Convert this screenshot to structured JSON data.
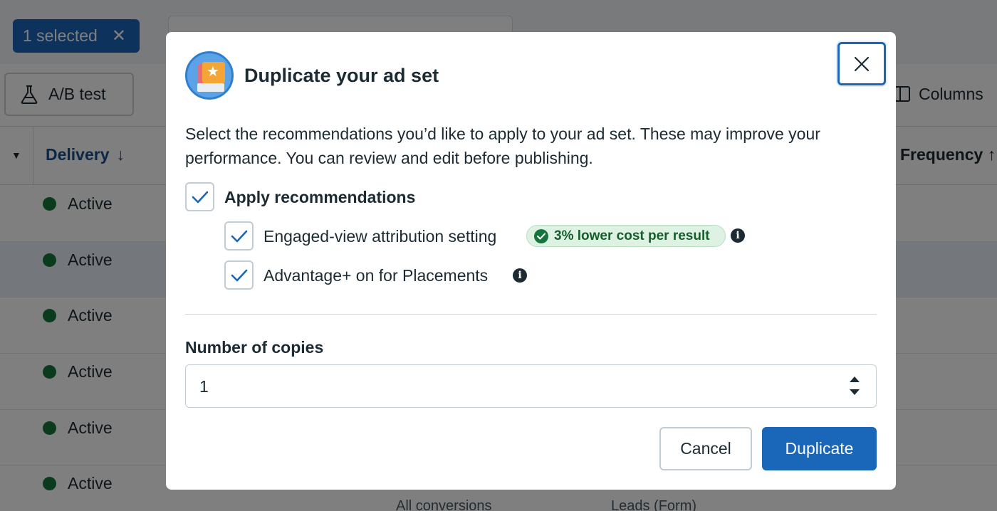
{
  "background": {
    "selection": {
      "label": "1 selected",
      "clear_glyph": "✕"
    },
    "toolbar": {
      "ab_test_label": "A/B test",
      "columns_label": "Columns"
    },
    "table": {
      "header_delivery": "Delivery",
      "header_delivery_sort": "↓",
      "header_frequency": "Frequency ↑",
      "rows": [
        {
          "status": "Active"
        },
        {
          "status": "Active"
        },
        {
          "status": "Active"
        },
        {
          "status": "Active"
        },
        {
          "status": "Active"
        },
        {
          "status": "Active"
        }
      ],
      "footer_cells": [
        "All conversions",
        "Leads (Form)"
      ]
    }
  },
  "modal": {
    "icon": "ad-set-duplicate-icon",
    "title": "Duplicate your ad set",
    "close_icon": "close-icon",
    "description": "Select the recommendations you’d like to apply to your ad set. These may improve your performance. You can review and edit before publishing.",
    "apply_recommendations": {
      "label": "Apply recommendations",
      "checked": true
    },
    "recommendations": [
      {
        "label": "Engaged-view attribution setting",
        "checked": true,
        "badge": "3% lower cost per result",
        "info_glyph": "i"
      },
      {
        "label": "Advantage+ on for Placements",
        "checked": true,
        "info_glyph": "i"
      }
    ],
    "copies": {
      "label": "Number of copies",
      "value": "1"
    },
    "buttons": {
      "cancel": "Cancel",
      "duplicate": "Duplicate"
    }
  },
  "colors": {
    "primary": "#1a66b8",
    "success": "#15763b",
    "badge_bg": "#def2e3",
    "overlay": "rgba(0,0,0,0.5)"
  }
}
